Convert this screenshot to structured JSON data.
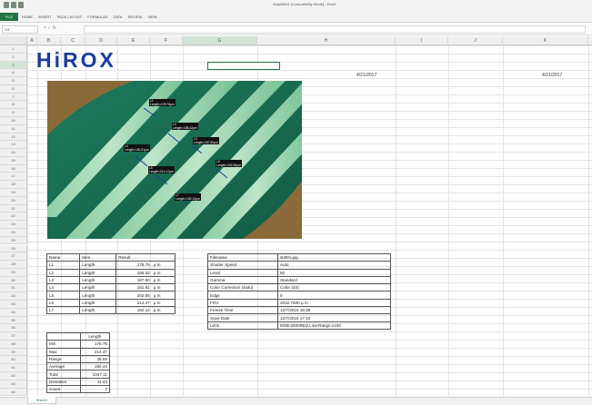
{
  "window": {
    "title": "Amplified1 [Compatibility Mode] - Excel",
    "file_tab": "FILE",
    "tabs": [
      "HOME",
      "INSERT",
      "PAGE LAYOUT",
      "FORMULAS",
      "DATA",
      "REVIEW",
      "VIEW"
    ]
  },
  "formula_bar": {
    "name_box": "G3",
    "buttons": "× ✓ fx",
    "value": ""
  },
  "grid": {
    "columns": [
      "A",
      "B",
      "C",
      "D",
      "E",
      "F",
      "G",
      "H",
      "I",
      "J",
      "K",
      "L"
    ],
    "selected_column": "G",
    "rows": [
      "1",
      "2",
      "3",
      "4",
      "5",
      "6",
      "7",
      "8",
      "9",
      "10",
      "11",
      "12",
      "13",
      "14",
      "15",
      "16",
      "17",
      "18",
      "19",
      "20",
      "21",
      "22",
      "23",
      "24",
      "25",
      "26",
      "27",
      "28",
      "29",
      "30",
      "31",
      "32",
      "33",
      "34",
      "35",
      "36",
      "37",
      "38",
      "39",
      "40",
      "41",
      "42",
      "43",
      "44"
    ],
    "selected_row": "3"
  },
  "logo": "HiROX",
  "dates": [
    "4/21/2017",
    "4/21/2017"
  ],
  "image_labels": [
    {
      "name": "L1",
      "text": "Length=178.76μm"
    },
    {
      "name": "L2",
      "text": "Length=185.42μm"
    },
    {
      "name": "L3",
      "text": "Length=187.80μm"
    },
    {
      "name": "L4",
      "text": "Length=181.81μm"
    },
    {
      "name": "L5",
      "text": "Length=202.56μm"
    },
    {
      "name": "L6",
      "text": "Length=214.47μm"
    },
    {
      "name": "L7",
      "text": "Length=192.12μm"
    }
  ],
  "results_table": {
    "headers": [
      "Name",
      "Item",
      "Result"
    ],
    "rows": [
      [
        "L1",
        "Length",
        "178.76",
        "μ m"
      ],
      [
        "L2",
        "Length",
        "185.42",
        "μ m"
      ],
      [
        "L3",
        "Length",
        "187.80",
        "μ m"
      ],
      [
        "L4",
        "Length",
        "181.81",
        "μ m"
      ],
      [
        "L5",
        "Length",
        "202.56",
        "μ m"
      ],
      [
        "L6",
        "Length",
        "214.47",
        "μ m"
      ],
      [
        "L7",
        "Length",
        "192.12",
        "μ m"
      ]
    ]
  },
  "info_table": {
    "rows": [
      [
        "Filename",
        "sti001.jpg"
      ],
      [
        "Shutter Speed",
        "Auto"
      ],
      [
        "Level",
        "92"
      ],
      [
        "Gamma",
        "Standard"
      ],
      [
        "Color Correction (Satu)",
        "Color 2(S)"
      ],
      [
        "Edge",
        "9"
      ],
      [
        "FOV",
        "2032.7600 μ m"
      ],
      [
        "Freeze Time",
        "12/7/2016 15:38"
      ],
      [
        "Save Date",
        "12/7/2016 17:10"
      ],
      [
        "Lens",
        "MXB-2500REZ,Low-Range,x100"
      ]
    ]
  },
  "stats_table": {
    "header": "Length",
    "rows": [
      [
        "Min",
        "178.76"
      ],
      [
        "Max",
        "214.47"
      ],
      [
        "Range",
        "35.66"
      ],
      [
        "Average",
        "192.44"
      ],
      [
        "Total",
        "1347.11"
      ],
      [
        "Deviation",
        "11.44"
      ],
      [
        "Count",
        "7"
      ]
    ]
  },
  "sheet_tab": "Sheet1"
}
